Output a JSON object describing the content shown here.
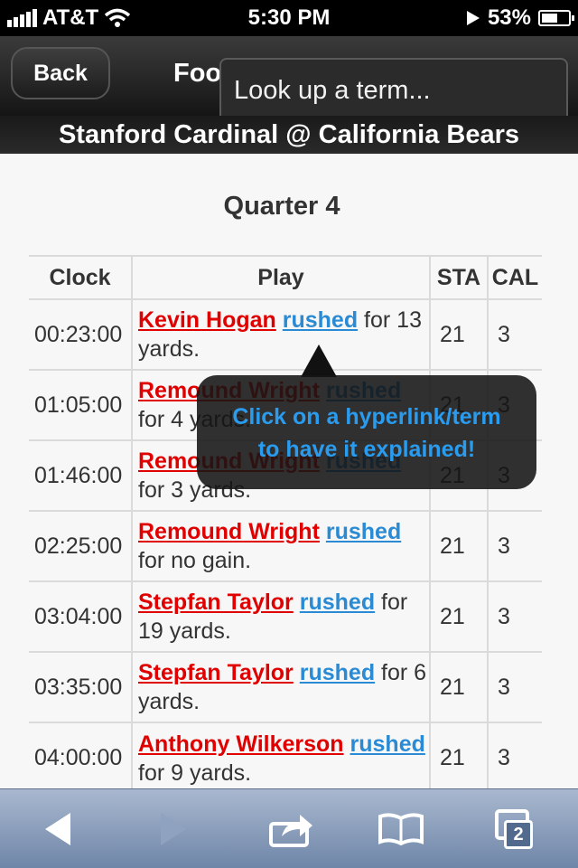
{
  "status": {
    "carrier": "AT&T",
    "time": "5:30 PM",
    "battery": "53%"
  },
  "nav": {
    "back_label": "Back",
    "title": "Foo"
  },
  "search": {
    "placeholder": "Look up a term..."
  },
  "game": {
    "header": "Stanford Cardinal @ California Bears",
    "quarter": "Quarter 4"
  },
  "table": {
    "headers": [
      "Clock",
      "Play",
      "STA",
      "CAL"
    ],
    "rows": [
      {
        "clock": "00:23:00",
        "player": "Kevin Hogan",
        "term": "rushed",
        "after": " for 13 yards.",
        "sta": "21",
        "cal": "3"
      },
      {
        "clock": "01:05:00",
        "player": "Remound Wright",
        "term": "rushed",
        "after": " for 4 yards.",
        "sta": "21",
        "cal": "3"
      },
      {
        "clock": "01:46:00",
        "player": "Remound Wright",
        "term": "rushed",
        "after": " for 3 yards.",
        "sta": "21",
        "cal": "3"
      },
      {
        "clock": "02:25:00",
        "player": "Remound Wright",
        "term": "rushed",
        "after": " for no gain.",
        "sta": "21",
        "cal": "3"
      },
      {
        "clock": "03:04:00",
        "player": "Stepfan Taylor",
        "term": "rushed",
        "after": " for 19 yards.",
        "sta": "21",
        "cal": "3"
      },
      {
        "clock": "03:35:00",
        "player": "Stepfan Taylor",
        "term": "rushed",
        "after": " for 6 yards.",
        "sta": "21",
        "cal": "3"
      },
      {
        "clock": "04:00:00",
        "player": "Anthony Wilkerson",
        "term": "rushed",
        "after": " for 9 yards.",
        "sta": "21",
        "cal": "3"
      }
    ]
  },
  "tooltip": {
    "line1": "Click on a hyperlink/term",
    "line2": "to have it explained!"
  },
  "toolbar": {
    "tab_count": "2"
  },
  "icons": [
    "signal-icon",
    "wifi-icon",
    "play-icon",
    "battery-icon",
    "back-arrow-icon",
    "forward-arrow-icon",
    "share-icon",
    "bookmarks-icon",
    "tabs-icon"
  ]
}
